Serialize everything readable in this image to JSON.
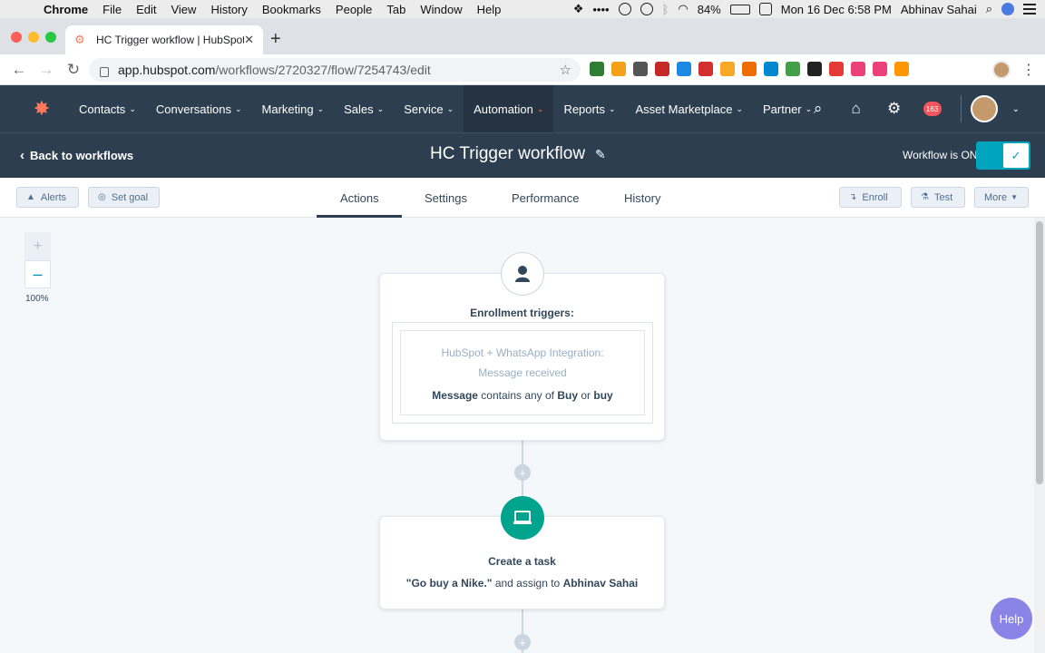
{
  "menubar": {
    "app": "Chrome",
    "items": [
      "File",
      "Edit",
      "View",
      "History",
      "Bookmarks",
      "People",
      "Tab",
      "Window",
      "Help"
    ],
    "battery": "84%",
    "datetime": "Mon 16 Dec  6:58 PM",
    "user": "Abhinav Sahai"
  },
  "browser": {
    "tab_title": "HC Trigger workflow | HubSpot",
    "url_host": "app.hubspot.com",
    "url_path": "/workflows/2720327/flow/7254743/edit"
  },
  "nav": {
    "items": [
      {
        "label": "Contacts"
      },
      {
        "label": "Conversations"
      },
      {
        "label": "Marketing"
      },
      {
        "label": "Sales"
      },
      {
        "label": "Service"
      },
      {
        "label": "Automation"
      },
      {
        "label": "Reports"
      },
      {
        "label": "Asset Marketplace"
      },
      {
        "label": "Partner"
      }
    ],
    "notification_count": "163"
  },
  "workflow": {
    "back_label": "Back to workflows",
    "title": "HC Trigger workflow",
    "status_label": "Workflow is ON"
  },
  "toolbar": {
    "alerts": "Alerts",
    "set_goal": "Set goal",
    "tabs": [
      "Actions",
      "Settings",
      "Performance",
      "History"
    ],
    "enroll": "Enroll",
    "test": "Test",
    "more": "More"
  },
  "canvas": {
    "zoom_level": "100%",
    "trigger_title": "Enrollment triggers:",
    "trigger_line1": "HubSpot + WhatsApp Integration:",
    "trigger_line2": "Message received",
    "trigger_prop": "Message",
    "trigger_op": "contains any of",
    "trigger_val1": "Buy",
    "trigger_or": "or",
    "trigger_val2": "buy",
    "task_title": "Create a task",
    "task_name": "\"Go buy a Nike.\"",
    "task_assign": "and assign to",
    "task_owner": "Abhinav Sahai"
  },
  "help": "Help",
  "colors": {
    "nav_bg": "#2d3e50",
    "accent_orange": "#ff7a59",
    "toggle_teal": "#00a4bd",
    "task_green": "#00a38d",
    "help_purple": "#8a84e6"
  }
}
